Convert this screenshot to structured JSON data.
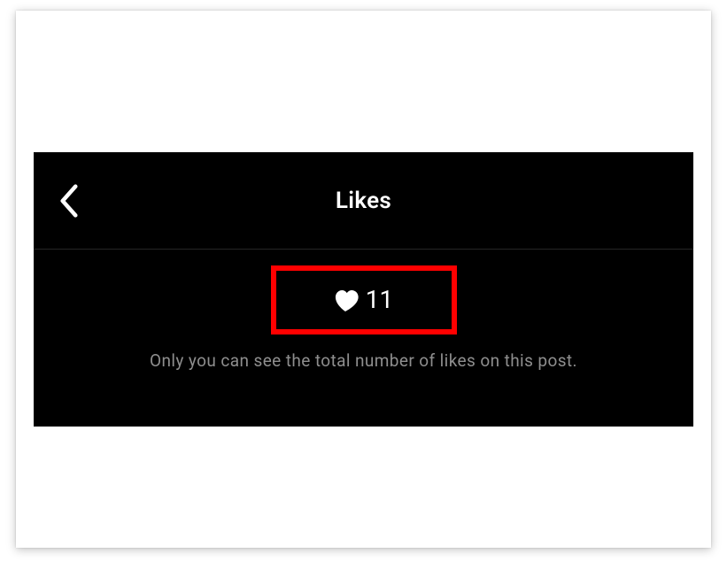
{
  "header": {
    "title": "Likes"
  },
  "likes": {
    "count": "11",
    "info": "Only you can see the total number of likes on this post."
  }
}
